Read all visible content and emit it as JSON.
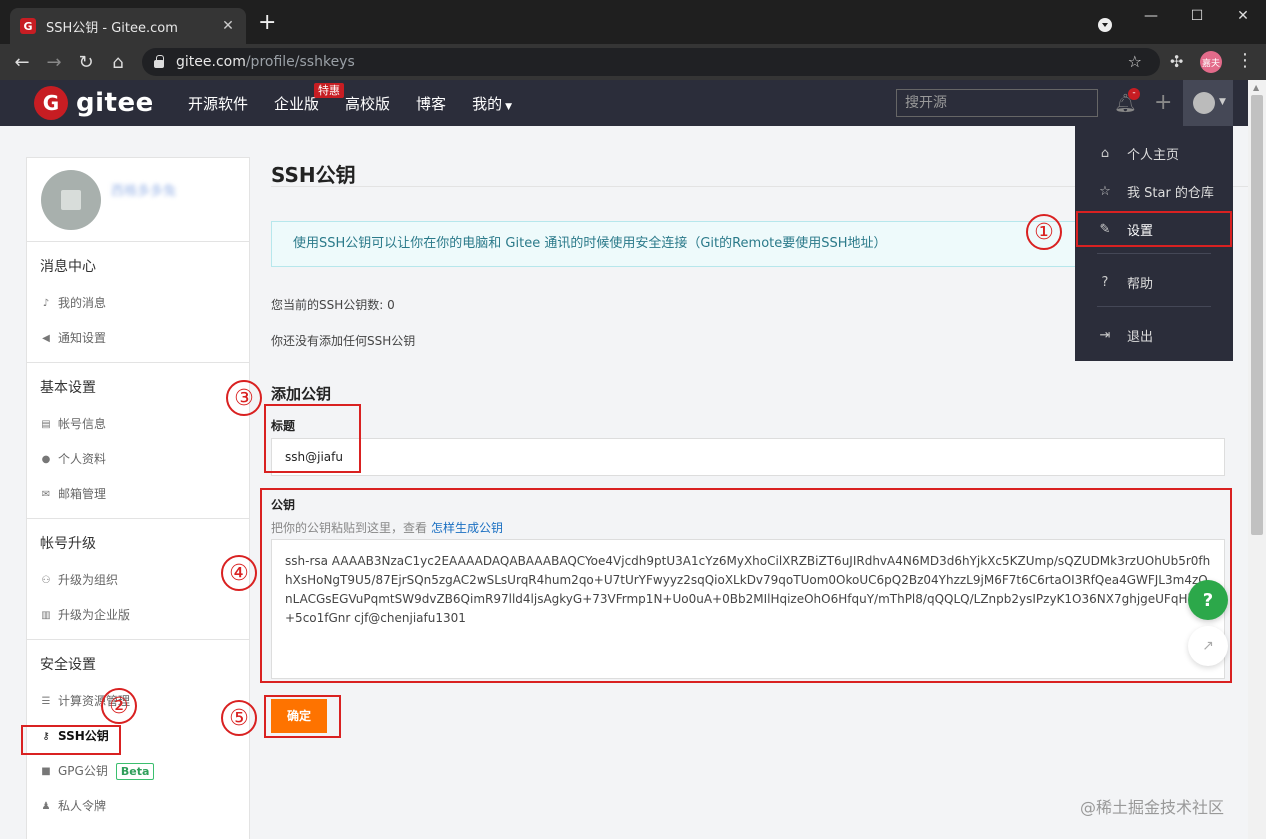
{
  "browser": {
    "tab_title": "SSH公钥 - Gitee.com",
    "tab_favicon": "G",
    "url_host": "gitee.com",
    "url_path": "/profile/sshkeys",
    "profile_chip": "嘉夫"
  },
  "header": {
    "logo_text": "gitee",
    "nav": [
      "开源软件",
      "企业版",
      "高校版",
      "博客",
      "我的"
    ],
    "hot_badge": "特惠",
    "search_placeholder": "搜开源",
    "bell_badge": "-"
  },
  "dropdown": {
    "items": [
      "个人主页",
      "我 Star 的仓库",
      "设置",
      "帮助",
      "退出"
    ]
  },
  "sidebar": {
    "username": "西格多多兔",
    "sections": [
      {
        "title": "消息中心",
        "items": [
          "我的消息",
          "通知设置"
        ]
      },
      {
        "title": "基本设置",
        "items": [
          "帐号信息",
          "个人资料",
          "邮箱管理"
        ]
      },
      {
        "title": "帐号升级",
        "items": [
          "升级为组织",
          "升级为企业版"
        ]
      },
      {
        "title": "安全设置",
        "items": [
          "计算资源管理",
          "SSH公钥",
          "GPG公钥",
          "私人令牌"
        ]
      }
    ],
    "beta_badge": "Beta"
  },
  "main": {
    "title": "SSH公钥",
    "info": "使用SSH公钥可以让你在你的电脑和 Gitee 通讯的时候使用安全连接（Git的Remote要使用SSH地址）",
    "key_count": "您当前的SSH公钥数: 0",
    "no_key": "你还没有添加任何SSH公钥",
    "add_title": "添加公钥",
    "title_label": "标题",
    "title_value": "ssh@jiafu",
    "key_label": "公钥",
    "key_hint": "把你的公钥粘贴到这里，查看",
    "key_hint_link": "怎样生成公钥",
    "key_value": "ssh-rsa AAAAB3NzaC1yc2EAAAADAQABAAABAQCYoe4Vjcdh9ptU3A1cYz6MyXhoCilXRZBiZT6uJIRdhvA4N6MD3d6hYjkXc5KZUmp/sQZUDMk3rzUOhUb5r0fhhXsHoNgT9U5/87EjrSQn5zgAC2wSLsUrqR4hum2qo+U7tUrYFwyyz2sqQioXLkDv79qoTUom0OkoUC6pQ2Bz04YhzzL9jM6F7t6C6rtaOI3RfQea4GWFJL3m4zQnLACGsEGVuPqmtSW9dvZB6QimR97lld4ljsAgkyG+73VFrmp1N+Uo0uA+0Bb2MIlHqizeOhO6HfquY/mThPl8/qQQLQ/LZnpb2ysIPzyK1O36NX7ghjgeUFqHkD+5co1fGnr cjf@chenjiafu1301",
    "submit": "确定"
  },
  "annotations": [
    "①",
    "②",
    "③",
    "④",
    "⑤"
  ],
  "watermark": "@稀土掘金技术社区",
  "colors": {
    "brand": "#c71d23",
    "header": "#2b2d3a",
    "submit": "#fe7300",
    "annotation": "#d92121"
  }
}
